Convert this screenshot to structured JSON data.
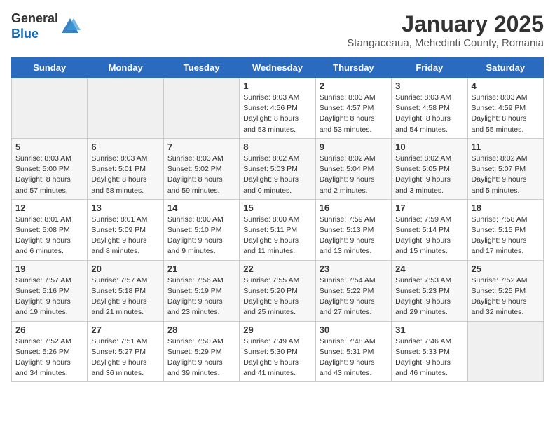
{
  "header": {
    "logo_line1": "General",
    "logo_line2": "Blue",
    "calendar_title": "January 2025",
    "calendar_subtitle": "Stangaceaua, Mehedinti County, Romania"
  },
  "weekdays": [
    "Sunday",
    "Monday",
    "Tuesday",
    "Wednesday",
    "Thursday",
    "Friday",
    "Saturday"
  ],
  "weeks": [
    [
      {
        "day": "",
        "info": ""
      },
      {
        "day": "",
        "info": ""
      },
      {
        "day": "",
        "info": ""
      },
      {
        "day": "1",
        "info": "Sunrise: 8:03 AM\nSunset: 4:56 PM\nDaylight: 8 hours\nand 53 minutes."
      },
      {
        "day": "2",
        "info": "Sunrise: 8:03 AM\nSunset: 4:57 PM\nDaylight: 8 hours\nand 53 minutes."
      },
      {
        "day": "3",
        "info": "Sunrise: 8:03 AM\nSunset: 4:58 PM\nDaylight: 8 hours\nand 54 minutes."
      },
      {
        "day": "4",
        "info": "Sunrise: 8:03 AM\nSunset: 4:59 PM\nDaylight: 8 hours\nand 55 minutes."
      }
    ],
    [
      {
        "day": "5",
        "info": "Sunrise: 8:03 AM\nSunset: 5:00 PM\nDaylight: 8 hours\nand 57 minutes."
      },
      {
        "day": "6",
        "info": "Sunrise: 8:03 AM\nSunset: 5:01 PM\nDaylight: 8 hours\nand 58 minutes."
      },
      {
        "day": "7",
        "info": "Sunrise: 8:03 AM\nSunset: 5:02 PM\nDaylight: 8 hours\nand 59 minutes."
      },
      {
        "day": "8",
        "info": "Sunrise: 8:02 AM\nSunset: 5:03 PM\nDaylight: 9 hours\nand 0 minutes."
      },
      {
        "day": "9",
        "info": "Sunrise: 8:02 AM\nSunset: 5:04 PM\nDaylight: 9 hours\nand 2 minutes."
      },
      {
        "day": "10",
        "info": "Sunrise: 8:02 AM\nSunset: 5:05 PM\nDaylight: 9 hours\nand 3 minutes."
      },
      {
        "day": "11",
        "info": "Sunrise: 8:02 AM\nSunset: 5:07 PM\nDaylight: 9 hours\nand 5 minutes."
      }
    ],
    [
      {
        "day": "12",
        "info": "Sunrise: 8:01 AM\nSunset: 5:08 PM\nDaylight: 9 hours\nand 6 minutes."
      },
      {
        "day": "13",
        "info": "Sunrise: 8:01 AM\nSunset: 5:09 PM\nDaylight: 9 hours\nand 8 minutes."
      },
      {
        "day": "14",
        "info": "Sunrise: 8:00 AM\nSunset: 5:10 PM\nDaylight: 9 hours\nand 9 minutes."
      },
      {
        "day": "15",
        "info": "Sunrise: 8:00 AM\nSunset: 5:11 PM\nDaylight: 9 hours\nand 11 minutes."
      },
      {
        "day": "16",
        "info": "Sunrise: 7:59 AM\nSunset: 5:13 PM\nDaylight: 9 hours\nand 13 minutes."
      },
      {
        "day": "17",
        "info": "Sunrise: 7:59 AM\nSunset: 5:14 PM\nDaylight: 9 hours\nand 15 minutes."
      },
      {
        "day": "18",
        "info": "Sunrise: 7:58 AM\nSunset: 5:15 PM\nDaylight: 9 hours\nand 17 minutes."
      }
    ],
    [
      {
        "day": "19",
        "info": "Sunrise: 7:57 AM\nSunset: 5:16 PM\nDaylight: 9 hours\nand 19 minutes."
      },
      {
        "day": "20",
        "info": "Sunrise: 7:57 AM\nSunset: 5:18 PM\nDaylight: 9 hours\nand 21 minutes."
      },
      {
        "day": "21",
        "info": "Sunrise: 7:56 AM\nSunset: 5:19 PM\nDaylight: 9 hours\nand 23 minutes."
      },
      {
        "day": "22",
        "info": "Sunrise: 7:55 AM\nSunset: 5:20 PM\nDaylight: 9 hours\nand 25 minutes."
      },
      {
        "day": "23",
        "info": "Sunrise: 7:54 AM\nSunset: 5:22 PM\nDaylight: 9 hours\nand 27 minutes."
      },
      {
        "day": "24",
        "info": "Sunrise: 7:53 AM\nSunset: 5:23 PM\nDaylight: 9 hours\nand 29 minutes."
      },
      {
        "day": "25",
        "info": "Sunrise: 7:52 AM\nSunset: 5:25 PM\nDaylight: 9 hours\nand 32 minutes."
      }
    ],
    [
      {
        "day": "26",
        "info": "Sunrise: 7:52 AM\nSunset: 5:26 PM\nDaylight: 9 hours\nand 34 minutes."
      },
      {
        "day": "27",
        "info": "Sunrise: 7:51 AM\nSunset: 5:27 PM\nDaylight: 9 hours\nand 36 minutes."
      },
      {
        "day": "28",
        "info": "Sunrise: 7:50 AM\nSunset: 5:29 PM\nDaylight: 9 hours\nand 39 minutes."
      },
      {
        "day": "29",
        "info": "Sunrise: 7:49 AM\nSunset: 5:30 PM\nDaylight: 9 hours\nand 41 minutes."
      },
      {
        "day": "30",
        "info": "Sunrise: 7:48 AM\nSunset: 5:31 PM\nDaylight: 9 hours\nand 43 minutes."
      },
      {
        "day": "31",
        "info": "Sunrise: 7:46 AM\nSunset: 5:33 PM\nDaylight: 9 hours\nand 46 minutes."
      },
      {
        "day": "",
        "info": ""
      }
    ]
  ]
}
